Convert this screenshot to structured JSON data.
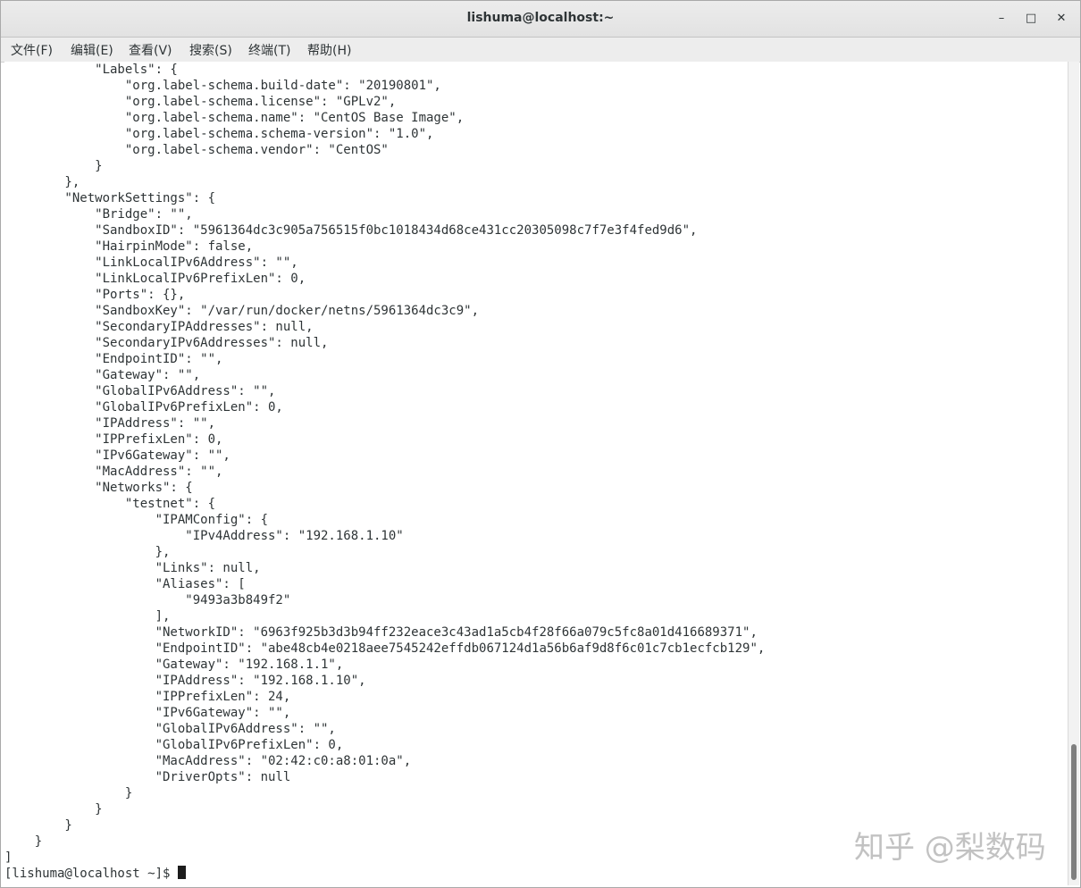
{
  "window": {
    "title": "lishuma@localhost:~",
    "controls": {
      "minimize": "–",
      "maximize": "□",
      "close": "✕"
    }
  },
  "menu": [
    "文件(F)",
    "编辑(E)",
    "查看(V)",
    "搜索(S)",
    "终端(T)",
    "帮助(H)"
  ],
  "terminal": {
    "lines": [
      "            \"Labels\": {",
      "                \"org.label-schema.build-date\": \"20190801\",",
      "                \"org.label-schema.license\": \"GPLv2\",",
      "                \"org.label-schema.name\": \"CentOS Base Image\",",
      "                \"org.label-schema.schema-version\": \"1.0\",",
      "                \"org.label-schema.vendor\": \"CentOS\"",
      "            }",
      "        },",
      "        \"NetworkSettings\": {",
      "            \"Bridge\": \"\",",
      "            \"SandboxID\": \"5961364dc3c905a756515f0bc1018434d68ce431cc20305098c7f7e3f4fed9d6\",",
      "            \"HairpinMode\": false,",
      "            \"LinkLocalIPv6Address\": \"\",",
      "            \"LinkLocalIPv6PrefixLen\": 0,",
      "            \"Ports\": {},",
      "            \"SandboxKey\": \"/var/run/docker/netns/5961364dc3c9\",",
      "            \"SecondaryIPAddresses\": null,",
      "            \"SecondaryIPv6Addresses\": null,",
      "            \"EndpointID\": \"\",",
      "            \"Gateway\": \"\",",
      "            \"GlobalIPv6Address\": \"\",",
      "            \"GlobalIPv6PrefixLen\": 0,",
      "            \"IPAddress\": \"\",",
      "            \"IPPrefixLen\": 0,",
      "            \"IPv6Gateway\": \"\",",
      "            \"MacAddress\": \"\",",
      "            \"Networks\": {",
      "                \"testnet\": {",
      "                    \"IPAMConfig\": {",
      "                        \"IPv4Address\": \"192.168.1.10\"",
      "                    },",
      "                    \"Links\": null,",
      "                    \"Aliases\": [",
      "                        \"9493a3b849f2\"",
      "                    ],",
      "                    \"NetworkID\": \"6963f925b3d3b94ff232eace3c43ad1a5cb4f28f66a079c5fc8a01d416689371\",",
      "                    \"EndpointID\": \"abe48cb4e0218aee7545242effdb067124d1a56b6af9d8f6c01c7cb1ecfcb129\",",
      "                    \"Gateway\": \"192.168.1.1\",",
      "                    \"IPAddress\": \"192.168.1.10\",",
      "                    \"IPPrefixLen\": 24,",
      "                    \"IPv6Gateway\": \"\",",
      "                    \"GlobalIPv6Address\": \"\",",
      "                    \"GlobalIPv6PrefixLen\": 0,",
      "                    \"MacAddress\": \"02:42:c0:a8:01:0a\",",
      "                    \"DriverOpts\": null",
      "                }",
      "            }",
      "        }",
      "    }",
      "]"
    ],
    "prompt": "[lishuma@localhost ~]$ "
  },
  "watermark": "知乎 @梨数码"
}
